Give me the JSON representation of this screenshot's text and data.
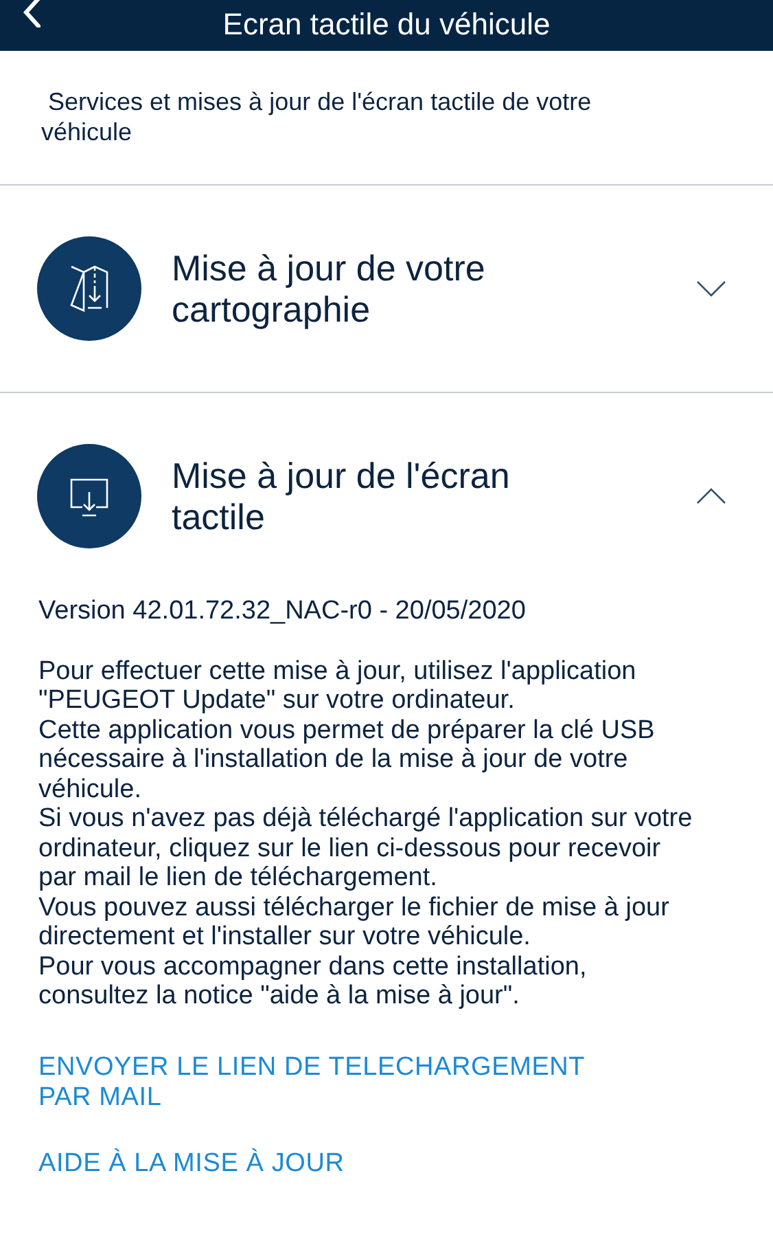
{
  "header": {
    "title": "Ecran tactile du véhicule"
  },
  "intro": " Services et mises à jour de l'écran tactile de votre véhicule",
  "sections": [
    {
      "kind": "map",
      "title": "Mise à jour de votre cartographie",
      "expanded": false
    },
    {
      "kind": "screen",
      "title": "Mise à jour de l'écran tactile",
      "expanded": true,
      "version": "Version 42.01.72.32_NAC-r0 - 20/05/2020",
      "paragraphs": [
        "Pour effectuer cette mise à jour, utilisez l'application \"PEUGEOT Update\" sur votre ordinateur.",
        "Cette application vous permet de préparer la clé USB nécessaire à l'installation de la mise à jour de votre véhicule.",
        "Si vous n'avez pas déjà téléchargé l'application sur votre ordinateur, cliquez sur le lien ci-dessous pour recevoir par mail le lien de téléchargement.",
        "Vous pouvez aussi télécharger le fichier de mise à jour directement et l'installer sur votre véhicule.",
        "Pour vous accompagner dans cette installation, consultez la notice \"aide à la mise à jour\"."
      ],
      "links": [
        "ENVOYER LE LIEN DE TELECHARGEMENT PAR MAIL",
        "AIDE À LA MISE À JOUR"
      ]
    }
  ]
}
